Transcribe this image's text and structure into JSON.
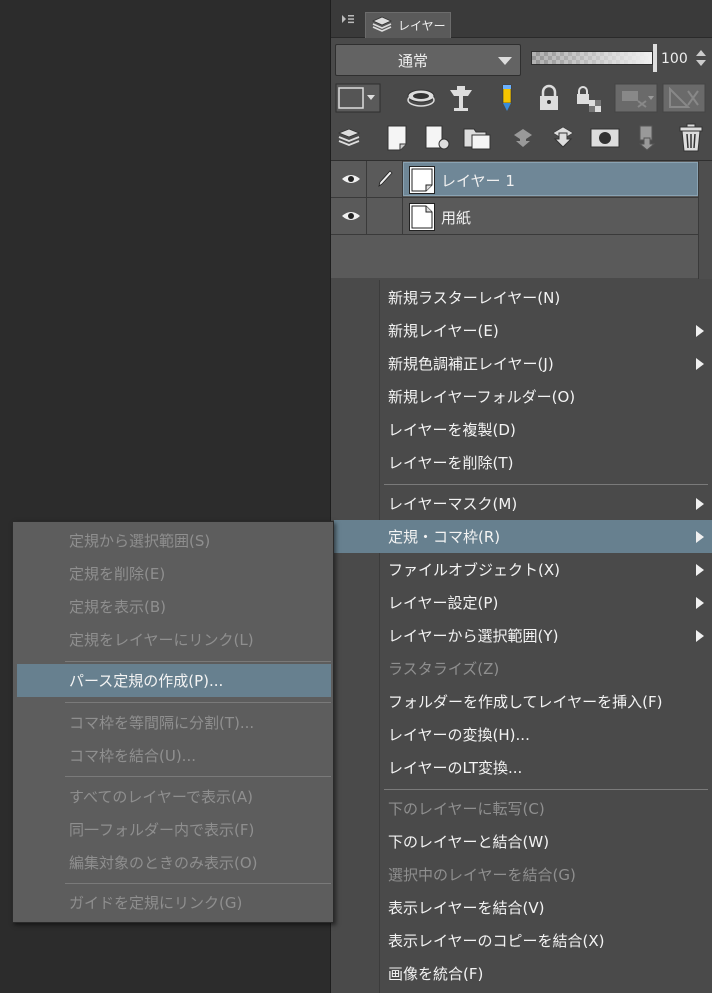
{
  "panel": {
    "tab_label": "レイヤー",
    "blend_mode": "通常",
    "opacity": "100",
    "opacity_fraction": 1.0
  },
  "tool_icons_row1": [
    "layer-color-button",
    "clip-layer-icon",
    "reference-layer-icon",
    "draft-layer-icon",
    "lock-layer-icon",
    "lock-transparency-icon",
    "mask-enable-icon",
    "ruler-display-icon"
  ],
  "tool_icons_row2": [
    "layer-properties-icon",
    "new-raster-layer-icon",
    "new-vector-layer-icon",
    "new-folder-icon",
    "transfer-down-icon",
    "merge-down-icon",
    "create-mask-icon",
    "apply-mask-icon",
    "delete-layer-icon"
  ],
  "layers": [
    {
      "name": "レイヤー 1",
      "selected": true,
      "visible": true,
      "editing": true
    },
    {
      "name": "用紙",
      "selected": false,
      "visible": true,
      "editing": false
    }
  ],
  "context_menu": {
    "items": [
      {
        "label": "新規ラスターレイヤー(N)",
        "submenu": false,
        "disabled": false
      },
      {
        "label": "新規レイヤー(E)",
        "submenu": true,
        "disabled": false
      },
      {
        "label": "新規色調補正レイヤー(J)",
        "submenu": true,
        "disabled": false
      },
      {
        "label": "新規レイヤーフォルダー(O)",
        "submenu": false,
        "disabled": false
      },
      {
        "label": "レイヤーを複製(D)",
        "submenu": false,
        "disabled": false
      },
      {
        "label": "レイヤーを削除(T)",
        "submenu": false,
        "disabled": false
      },
      {
        "label": "レイヤーマスク(M)",
        "submenu": true,
        "disabled": false
      },
      {
        "label": "定規・コマ枠(R)",
        "submenu": true,
        "disabled": false,
        "highlighted": true
      },
      {
        "label": "ファイルオブジェクト(X)",
        "submenu": true,
        "disabled": false
      },
      {
        "label": "レイヤー設定(P)",
        "submenu": true,
        "disabled": false
      },
      {
        "label": "レイヤーから選択範囲(Y)",
        "submenu": true,
        "disabled": false
      },
      {
        "label": "ラスタライズ(Z)",
        "submenu": false,
        "disabled": true
      },
      {
        "label": "フォルダーを作成してレイヤーを挿入(F)",
        "submenu": false,
        "disabled": false
      },
      {
        "label": "レイヤーの変換(H)...",
        "submenu": false,
        "disabled": false
      },
      {
        "label": "レイヤーのLT変換...",
        "submenu": false,
        "disabled": false
      },
      {
        "label": "下のレイヤーに転写(C)",
        "submenu": false,
        "disabled": true
      },
      {
        "label": "下のレイヤーと結合(W)",
        "submenu": false,
        "disabled": false
      },
      {
        "label": "選択中のレイヤーを結合(G)",
        "submenu": false,
        "disabled": true
      },
      {
        "label": "表示レイヤーを結合(V)",
        "submenu": false,
        "disabled": false
      },
      {
        "label": "表示レイヤーのコピーを結合(X)",
        "submenu": false,
        "disabled": false
      },
      {
        "label": "画像を統合(F)",
        "submenu": false,
        "disabled": false
      }
    ]
  },
  "ruler_submenu": {
    "items": [
      {
        "label": "定規から選択範囲(S)",
        "disabled": true
      },
      {
        "label": "定規を削除(E)",
        "disabled": true
      },
      {
        "label": "定規を表示(B)",
        "disabled": true
      },
      {
        "label": "定規をレイヤーにリンク(L)",
        "disabled": true
      },
      {
        "label": "パース定規の作成(P)...",
        "disabled": false,
        "highlighted": true
      },
      {
        "label": "コマ枠を等間隔に分割(T)...",
        "disabled": true
      },
      {
        "label": "コマ枠を結合(U)...",
        "disabled": true
      },
      {
        "label": "すべてのレイヤーで表示(A)",
        "disabled": true
      },
      {
        "label": "同一フォルダー内で表示(F)",
        "disabled": true
      },
      {
        "label": "編集対象のときのみ表示(O)",
        "disabled": true
      },
      {
        "label": "ガイドを定規にリンク(G)",
        "disabled": true
      }
    ]
  },
  "colors": {
    "highlight": "#67808f",
    "selected_layer": "#6f8797",
    "menu_bg": "#5d5d5d",
    "disabled_text": "#8f8f8f"
  }
}
